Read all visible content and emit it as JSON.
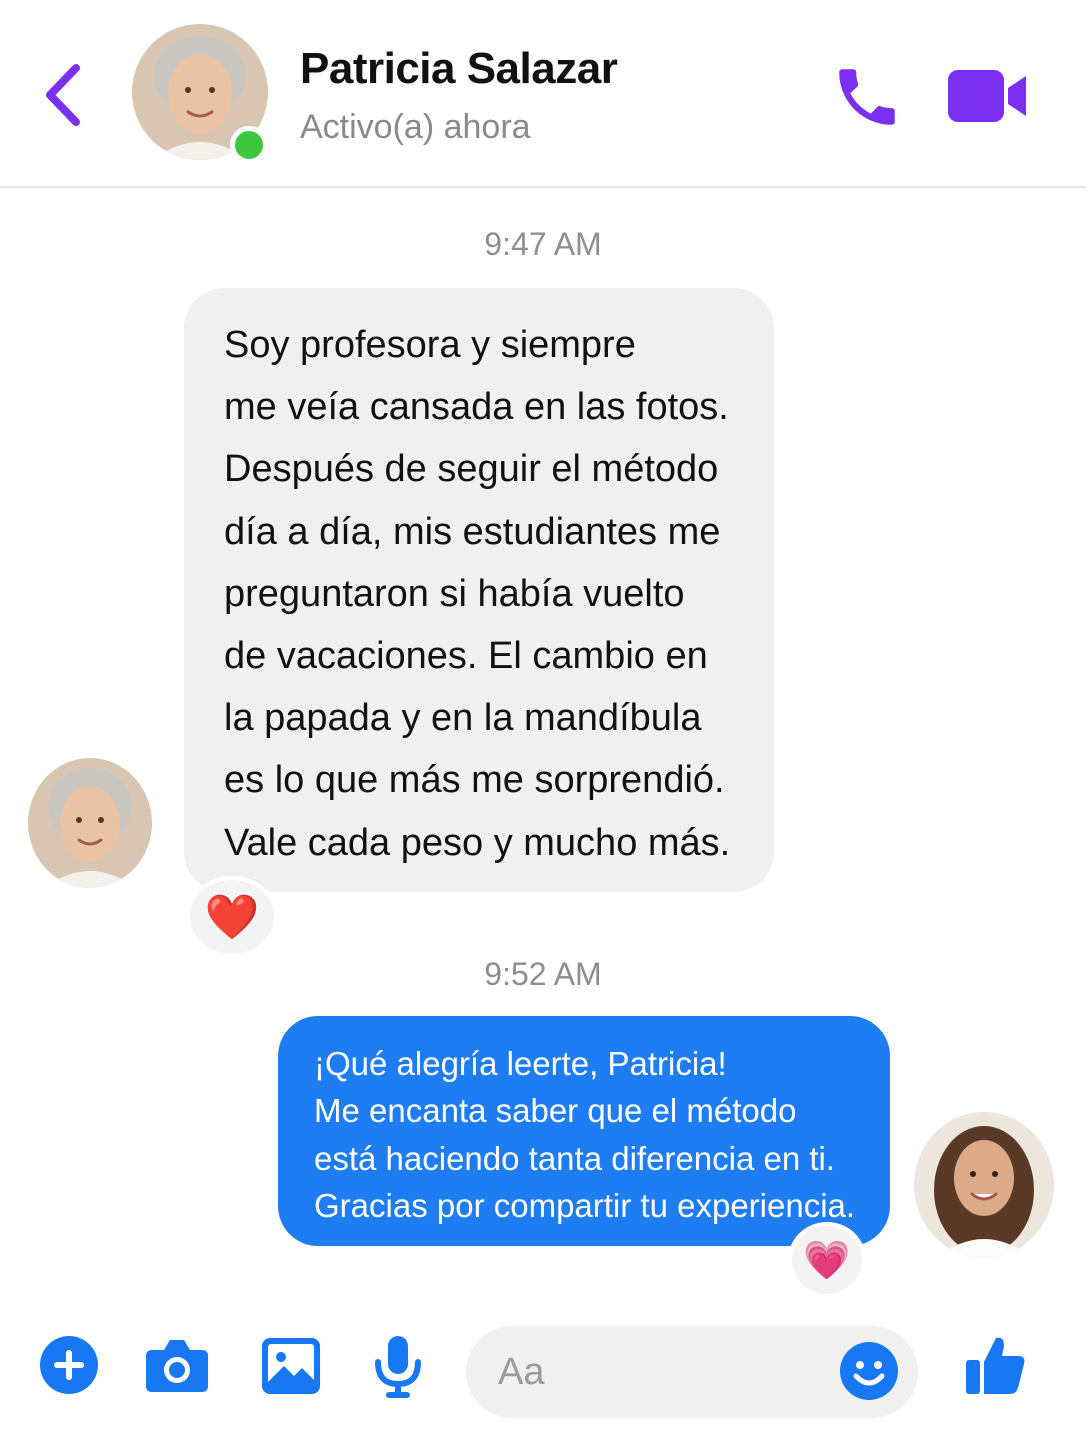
{
  "header": {
    "contact_name": "Patricia Salazar",
    "status": "Activo(a) ahora",
    "accent_color": "#7b2ff0",
    "presence_color": "#3ec63e"
  },
  "conversation": {
    "messages": [
      {
        "timestamp": "9:47 AM",
        "direction": "incoming",
        "lines": [
          "Soy profesora y siempre",
          "me veía cansada en las fotos.",
          "Después de seguir el método",
          "día a día, mis estudiantes me",
          "preguntaron si había vuelto",
          "de vacaciones. El cambio en",
          "la papada y en la mandíbula",
          "es lo que más me sorprendió.",
          "Vale cada peso y mucho más."
        ],
        "reaction": "❤️"
      },
      {
        "timestamp": "9:52 AM",
        "direction": "outgoing",
        "lines": [
          "¡Qué alegría leerte, Patricia!",
          "Me encanta saber que el método",
          "está haciendo tanta diferencia en ti.",
          "Gracias por compartir tu experiencia."
        ],
        "reaction": "💗"
      }
    ],
    "bubble_out_color": "#1e7df2",
    "bubble_in_color": "#f0f0f0"
  },
  "composer": {
    "placeholder": "Aa",
    "icons": [
      "plus-icon",
      "camera-icon",
      "image-icon",
      "microphone-icon",
      "emoji-icon",
      "thumbs-up-icon"
    ],
    "icon_color": "#1877f2"
  }
}
